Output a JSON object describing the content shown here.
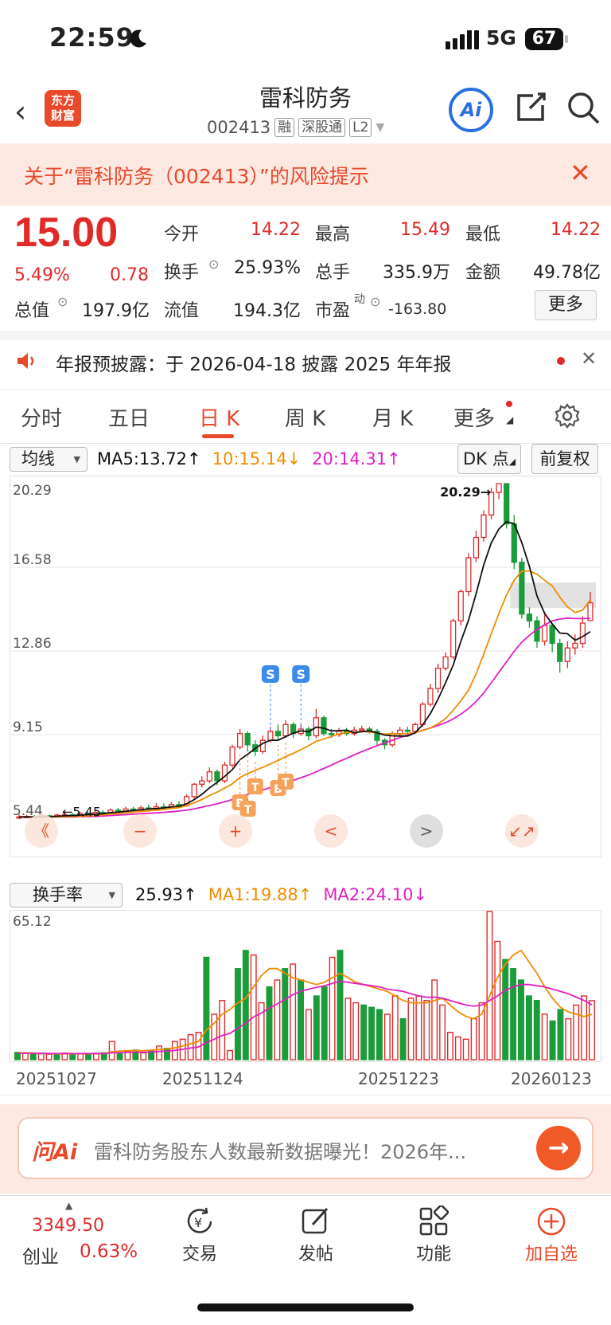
{
  "status_bar": {
    "time": "22:59",
    "network": "5G",
    "battery": "67"
  },
  "header": {
    "logo_text": "东方\n财富",
    "stock_name": "雷科防务",
    "stock_code": "002413",
    "tags": [
      "融",
      "深股通",
      "L2"
    ],
    "ai_label": "Ai"
  },
  "risk_banner": {
    "text": "关于“雷科防务（002413）”的风险提示"
  },
  "quote": {
    "price": "15.00",
    "change_pct": "5.49%",
    "change": "0.78",
    "fields": [
      {
        "label": "今开",
        "value": "14.22",
        "color": "red"
      },
      {
        "label": "最高",
        "value": "15.49",
        "color": "red"
      },
      {
        "label": "最低",
        "value": "14.22",
        "color": "red"
      },
      {
        "label": "换手",
        "value": "25.93%",
        "color": "plain"
      },
      {
        "label": "总手",
        "value": "335.9万",
        "color": "plain"
      },
      {
        "label": "金额",
        "value": "49.78亿",
        "color": "plain"
      },
      {
        "label": "总值",
        "value": "197.9亿",
        "color": "plain"
      },
      {
        "label": "流值",
        "value": "194.3亿",
        "color": "plain"
      },
      {
        "label": "市盈",
        "value": "-163.80",
        "color": "plain"
      }
    ],
    "pe_superscript": "动",
    "more_label": "更多"
  },
  "notice": {
    "text": "年报预披露：于 2026-04-18 披露 2025 年年报"
  },
  "tabs": [
    "分时",
    "五日",
    "日 K",
    "周 K",
    "月 K",
    "更多"
  ],
  "active_tab": "日 K",
  "chart_toolbar": {
    "ma_select": "均线",
    "ma5": "MA5:13.72",
    "ma10": "10:15.14",
    "ma20": "20:14.31",
    "dk_label": "DK 点",
    "fq_label": "前复权",
    "ma5_color": "#111111",
    "ma10_color": "#f08c00",
    "ma20_color": "#e020c0"
  },
  "volume_toolbar": {
    "select": "换手率",
    "value": "25.93",
    "ma1": "MA1:19.88",
    "ma2": "MA2:24.10"
  },
  "chart_data": [
    {
      "type": "candlestick",
      "y_ticks": [
        "20.29",
        "16.58",
        "12.86",
        "9.15",
        "5.44"
      ],
      "ylim": [
        5.44,
        20.29
      ],
      "high_label": "20.29",
      "low_label": "5.45",
      "markers": [
        "S",
        "S",
        "B",
        "T",
        "T",
        "B",
        "T"
      ],
      "candles": [
        [
          5.45,
          5.5,
          5.6,
          5.4
        ],
        [
          5.5,
          5.52,
          5.6,
          5.45
        ],
        [
          5.52,
          5.48,
          5.58,
          5.44
        ],
        [
          5.48,
          5.55,
          5.62,
          5.45
        ],
        [
          5.55,
          5.5,
          5.6,
          5.46
        ],
        [
          5.5,
          5.58,
          5.65,
          5.48
        ],
        [
          5.58,
          5.6,
          5.7,
          5.52
        ],
        [
          5.6,
          5.55,
          5.68,
          5.5
        ],
        [
          5.55,
          5.65,
          5.72,
          5.52
        ],
        [
          5.65,
          5.62,
          5.75,
          5.58
        ],
        [
          5.62,
          5.7,
          5.78,
          5.58
        ],
        [
          5.7,
          5.68,
          5.8,
          5.62
        ],
        [
          5.68,
          5.8,
          5.88,
          5.64
        ],
        [
          5.8,
          5.75,
          5.9,
          5.7
        ],
        [
          5.75,
          5.85,
          5.95,
          5.7
        ],
        [
          5.85,
          5.8,
          5.95,
          5.75
        ],
        [
          5.8,
          5.9,
          6.0,
          5.75
        ],
        [
          5.9,
          5.85,
          6.05,
          5.8
        ],
        [
          5.85,
          5.95,
          6.1,
          5.8
        ],
        [
          5.95,
          5.9,
          6.1,
          5.85
        ],
        [
          5.9,
          6.05,
          6.15,
          5.85
        ],
        [
          6.05,
          6.0,
          6.2,
          5.95
        ],
        [
          6.0,
          6.4,
          6.5,
          5.95
        ],
        [
          6.4,
          6.95,
          7.0,
          6.3
        ],
        [
          6.95,
          7.1,
          7.3,
          6.8
        ],
        [
          7.1,
          7.5,
          7.7,
          7.0
        ],
        [
          7.5,
          7.1,
          7.6,
          6.9
        ],
        [
          7.1,
          7.8,
          7.95,
          7.0
        ],
        [
          7.8,
          8.6,
          8.7,
          7.7
        ],
        [
          8.6,
          9.2,
          9.4,
          8.5
        ],
        [
          9.2,
          8.7,
          9.3,
          8.4
        ],
        [
          8.7,
          8.4,
          8.9,
          8.2
        ],
        [
          8.4,
          8.9,
          9.1,
          8.3
        ],
        [
          8.9,
          9.3,
          9.5,
          8.8
        ],
        [
          9.3,
          9.1,
          9.6,
          8.9
        ],
        [
          9.1,
          9.6,
          9.8,
          9.0
        ],
        [
          9.6,
          9.2,
          9.7,
          9.0
        ],
        [
          9.2,
          9.4,
          9.6,
          9.1
        ],
        [
          9.4,
          9.1,
          9.5,
          8.9
        ],
        [
          9.1,
          9.9,
          10.3,
          9.0
        ],
        [
          9.9,
          9.2,
          10.0,
          9.1
        ],
        [
          9.2,
          9.15,
          9.4,
          9.0
        ],
        [
          9.15,
          9.3,
          9.45,
          9.05
        ],
        [
          9.3,
          9.2,
          9.45,
          9.1
        ],
        [
          9.2,
          9.35,
          9.5,
          9.1
        ],
        [
          9.35,
          9.4,
          9.55,
          9.25
        ],
        [
          9.4,
          9.3,
          9.5,
          9.2
        ],
        [
          9.3,
          8.9,
          9.4,
          8.7
        ],
        [
          8.9,
          8.7,
          9.0,
          8.5
        ],
        [
          8.7,
          9.2,
          9.3,
          8.6
        ],
        [
          9.2,
          9.35,
          9.5,
          9.1
        ],
        [
          9.35,
          9.3,
          9.5,
          9.2
        ],
        [
          9.3,
          9.6,
          9.7,
          9.2
        ],
        [
          9.6,
          10.5,
          10.6,
          9.5
        ],
        [
          10.5,
          11.2,
          11.4,
          10.4
        ],
        [
          11.2,
          12.1,
          12.3,
          11.0
        ],
        [
          12.1,
          12.6,
          12.8,
          12.0
        ],
        [
          12.6,
          14.2,
          14.3,
          12.5
        ],
        [
          14.2,
          15.5,
          15.6,
          14.0
        ],
        [
          15.5,
          17.0,
          17.2,
          15.3
        ],
        [
          17.0,
          17.9,
          18.2,
          16.8
        ],
        [
          17.9,
          18.9,
          19.1,
          17.7
        ],
        [
          18.9,
          19.9,
          20.1,
          18.7
        ],
        [
          19.9,
          20.29,
          20.29,
          19.6
        ],
        [
          20.29,
          18.5,
          20.29,
          18.3
        ],
        [
          18.5,
          16.8,
          18.9,
          16.5
        ],
        [
          16.8,
          14.5,
          17.0,
          14.3
        ],
        [
          14.5,
          14.2,
          14.8,
          13.9
        ],
        [
          14.2,
          13.3,
          14.4,
          13.0
        ],
        [
          13.3,
          14.0,
          14.6,
          13.1
        ],
        [
          14.0,
          13.2,
          14.1,
          12.8
        ],
        [
          13.2,
          12.4,
          13.4,
          11.9
        ],
        [
          12.4,
          13.0,
          13.3,
          12.1
        ],
        [
          13.0,
          13.2,
          13.6,
          12.7
        ],
        [
          13.2,
          14.1,
          14.4,
          13.0
        ],
        [
          14.22,
          15.0,
          15.49,
          14.22
        ]
      ],
      "ma5": [
        5.5,
        5.5,
        5.5,
        5.51,
        5.51,
        5.53,
        5.55,
        5.56,
        5.58,
        5.6,
        5.62,
        5.64,
        5.69,
        5.71,
        5.75,
        5.78,
        5.82,
        5.85,
        5.87,
        5.9,
        5.95,
        5.97,
        6.08,
        6.27,
        6.5,
        6.79,
        7.03,
        7.3,
        7.6,
        8.04,
        8.28,
        8.54,
        8.76,
        8.9,
        8.9,
        9.06,
        9.22,
        9.32,
        9.28,
        9.48,
        9.44,
        9.32,
        9.33,
        9.35,
        9.24,
        9.28,
        9.32,
        9.23,
        9.13,
        9.1,
        9.09,
        9.09,
        9.23,
        9.59,
        10.09,
        10.72,
        11.46,
        12.24,
        13.29,
        14.22,
        15.4,
        16.68,
        17.66,
        18.28,
        18.6,
        18.51,
        17.68,
        16.62,
        15.3,
        14.53,
        14.06,
        13.66,
        13.63,
        13.34,
        13.5,
        13.72
      ],
      "ma10": [
        5.5,
        5.5,
        5.5,
        5.5,
        5.5,
        5.5,
        5.51,
        5.52,
        5.53,
        5.54,
        5.56,
        5.59,
        5.62,
        5.65,
        5.68,
        5.71,
        5.74,
        5.77,
        5.8,
        5.83,
        5.88,
        5.91,
        6.0,
        6.13,
        6.27,
        6.45,
        6.6,
        6.78,
        6.97,
        7.25,
        7.42,
        7.57,
        7.7,
        7.85,
        8.0,
        8.18,
        8.32,
        8.48,
        8.66,
        8.86,
        8.95,
        9.07,
        9.18,
        9.25,
        9.25,
        9.3,
        9.27,
        9.23,
        9.17,
        9.2,
        9.18,
        9.2,
        9.24,
        9.34,
        9.45,
        9.63,
        9.86,
        10.23,
        10.66,
        11.12,
        11.85,
        12.72,
        13.63,
        14.53,
        15.35,
        16.0,
        16.4,
        16.42,
        16.27,
        16.0,
        15.75,
        15.25,
        14.82,
        14.57,
        14.68,
        15.14
      ],
      "ma20": [
        5.5,
        5.5,
        5.5,
        5.5,
        5.5,
        5.5,
        5.5,
        5.5,
        5.51,
        5.51,
        5.52,
        5.54,
        5.56,
        5.58,
        5.6,
        5.62,
        5.64,
        5.66,
        5.68,
        5.7,
        5.73,
        5.76,
        5.8,
        5.86,
        5.93,
        6.01,
        6.08,
        6.17,
        6.27,
        6.4,
        6.5,
        6.6,
        6.7,
        6.8,
        6.9,
        7.02,
        7.12,
        7.24,
        7.36,
        7.5,
        7.65,
        7.8,
        7.96,
        8.1,
        8.25,
        8.4,
        8.53,
        8.66,
        8.78,
        8.9,
        9.02,
        9.13,
        9.23,
        9.35,
        9.45,
        9.56,
        9.68,
        9.85,
        10.06,
        10.31,
        10.62,
        11.0,
        11.45,
        11.92,
        12.38,
        12.85,
        13.25,
        13.56,
        13.82,
        14.02,
        14.2,
        14.28,
        14.32,
        14.3,
        14.3,
        14.31
      ]
    },
    {
      "type": "bar",
      "y_ticks": [
        "65.12"
      ],
      "ylim": [
        0,
        65.12
      ],
      "x_ticks": [
        "20251027",
        "20251124",
        "20251223",
        "20260123"
      ],
      "values": [
        3.2,
        2.8,
        2.5,
        2.6,
        2.4,
        2.2,
        2.9,
        2.3,
        2.6,
        2.4,
        2.8,
        3.0,
        8.0,
        2.9,
        3.5,
        4.2,
        3.0,
        4.0,
        6.0,
        5.0,
        8.0,
        9.0,
        11.0,
        12.0,
        45.0,
        20.0,
        26.0,
        4.0,
        40.0,
        48.0,
        46.0,
        25.0,
        32.0,
        35.0,
        40.0,
        42.0,
        35.0,
        22.0,
        28.0,
        32.0,
        45.0,
        48.0,
        27.0,
        25.0,
        24.0,
        23.0,
        22.0,
        20.0,
        28.0,
        18.0,
        27.0,
        28.0,
        26.0,
        35.0,
        24.0,
        12.0,
        10.0,
        9.0,
        18.0,
        25.0,
        65.12,
        52.0,
        44.0,
        40.0,
        35.0,
        28.0,
        26.0,
        20.0,
        17.0,
        22.0,
        18.0,
        24.0,
        28.0,
        25.93
      ],
      "colors": "rise-red-outline / fall-green-filled",
      "ma1": [
        3.0,
        3.0,
        2.9,
        2.8,
        2.7,
        2.6,
        2.6,
        2.6,
        2.6,
        2.6,
        2.6,
        2.7,
        3.5,
        3.8,
        4.0,
        4.0,
        4.0,
        4.2,
        4.5,
        4.8,
        5.2,
        6.0,
        7.0,
        8.0,
        13.0,
        16.0,
        20.0,
        22.0,
        25.0,
        27.0,
        32.0,
        37.0,
        40.0,
        40.0,
        38.0,
        36.0,
        35.0,
        34.0,
        33.0,
        34.0,
        36.0,
        38.0,
        36.0,
        34.0,
        33.0,
        32.0,
        31.0,
        30.0,
        28.0,
        26.0,
        25.0,
        25.0,
        25.0,
        26.0,
        27.0,
        24.0,
        21.0,
        19.0,
        18.0,
        20.0,
        28.0,
        36.0,
        42.0,
        46.0,
        48.0,
        43.0,
        38.0,
        32.0,
        27.0,
        23.0,
        21.0,
        20.0,
        19.0,
        19.88
      ],
      "ma2": [
        2.8,
        2.8,
        2.8,
        2.8,
        2.7,
        2.7,
        2.7,
        2.7,
        2.7,
        2.7,
        2.7,
        2.7,
        3.0,
        3.1,
        3.2,
        3.3,
        3.3,
        3.4,
        3.6,
        3.8,
        4.1,
        4.6,
        5.1,
        5.6,
        7.5,
        9.0,
        10.6,
        11.6,
        13.8,
        16.0,
        18.8,
        20.5,
        22.7,
        24.5,
        26.5,
        28.6,
        30.0,
        31.0,
        31.8,
        32.5,
        33.5,
        34.5,
        34.0,
        33.5,
        33.0,
        32.5,
        32.0,
        31.0,
        30.5,
        30.0,
        29.0,
        28.0,
        27.5,
        27.5,
        27.0,
        26.0,
        25.0,
        24.0,
        23.5,
        24.0,
        26.0,
        28.0,
        30.5,
        32.0,
        33.0,
        33.0,
        32.5,
        32.0,
        31.0,
        30.0,
        29.0,
        27.5,
        26.0,
        24.1
      ]
    }
  ],
  "chart_controls": [
    "《",
    "−",
    "+",
    "<",
    ">",
    "↙↗"
  ],
  "ask_ai": {
    "logo": "问Ai",
    "text": "雷科防务股东人数最新数据曝光！2026年..."
  },
  "bottom_nav": {
    "index_value": "3349.50",
    "index_name": "创业",
    "index_pct": "0.63%",
    "items": [
      "交易",
      "发帖",
      "功能",
      "加自选"
    ],
    "accent": "#e8492a"
  }
}
